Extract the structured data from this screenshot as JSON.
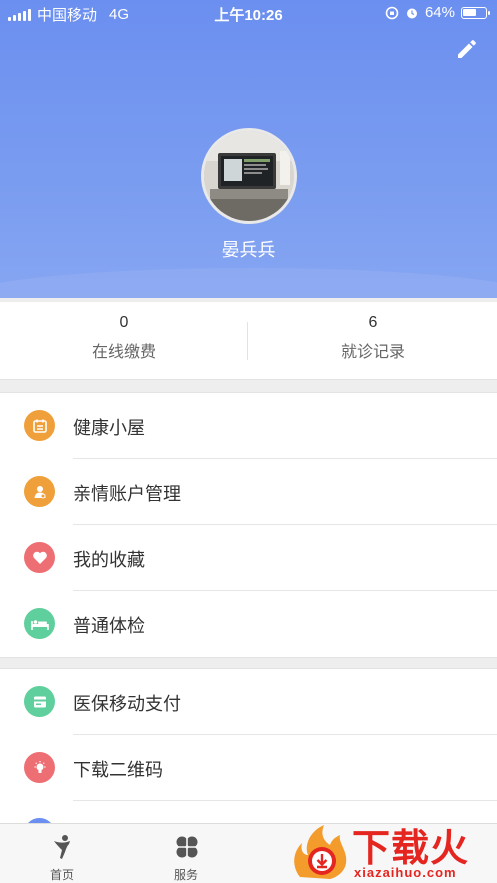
{
  "status_bar": {
    "carrier": "中国移动",
    "network": "4G",
    "time": "上午10:26",
    "battery": "64%",
    "battery_level": 0.64
  },
  "profile": {
    "name": "晏兵兵"
  },
  "stats": [
    {
      "value": "0",
      "label": "在线缴费"
    },
    {
      "value": "6",
      "label": "就诊记录"
    }
  ],
  "menu_group_1": [
    {
      "label": "健康小屋",
      "icon": "calendar-icon",
      "color": "#f0a03a"
    },
    {
      "label": "亲情账户管理",
      "icon": "family-icon",
      "color": "#f0a03a"
    },
    {
      "label": "我的收藏",
      "icon": "heart-icon",
      "color": "#ee6f73"
    },
    {
      "label": "普通体检",
      "icon": "bed-icon",
      "color": "#5fcf9d"
    }
  ],
  "menu_group_2": [
    {
      "label": "医保移动支付",
      "icon": "card-icon",
      "color": "#5fcf9d"
    },
    {
      "label": "下载二维码",
      "icon": "bulb-icon",
      "color": "#ee6f73"
    },
    {
      "label": "",
      "icon": "partial-icon",
      "color": "#6b8ff0"
    }
  ],
  "tabbar": [
    {
      "label": "首页",
      "icon": "person-icon"
    },
    {
      "label": "服务",
      "icon": "grid-icon"
    }
  ],
  "watermark": {
    "text": "下载火",
    "sub": "xiazaihuo.com"
  },
  "colors": {
    "header": "#6b8ff0",
    "accent_orange": "#f0a03a",
    "accent_red": "#ee6f73",
    "accent_green": "#5fcf9d",
    "watermark_red": "#e5251f"
  }
}
